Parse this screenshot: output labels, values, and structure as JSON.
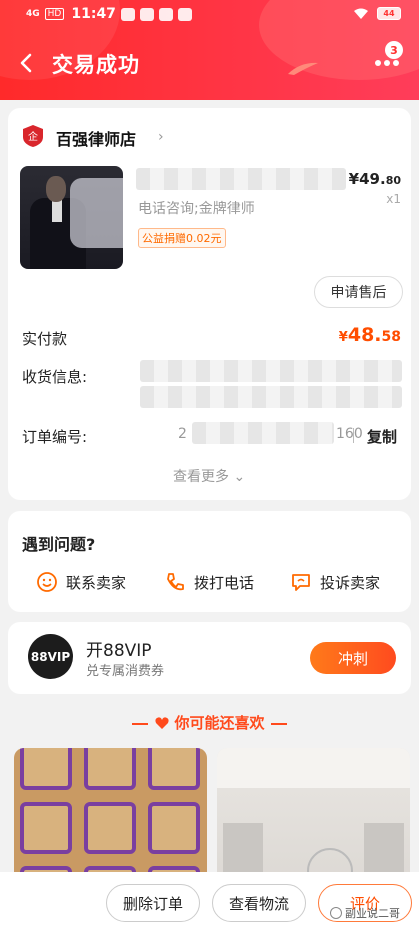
{
  "status_bar": {
    "signal": "4G",
    "hd": "HD",
    "time": "11:47",
    "battery": "44"
  },
  "header": {
    "title": "交易成功",
    "more_badge": "3"
  },
  "shop": {
    "name": "百强律师店"
  },
  "product": {
    "subtitle": "电话咨询;金牌律师",
    "charity_tag": "公益捐赠0.02元",
    "price_int": "¥49.",
    "price_dec": "80",
    "quantity": "x1",
    "after_sale_label": "申请售后"
  },
  "order": {
    "paid_label": "实付款",
    "paid_currency": "¥",
    "paid_int": "48.",
    "paid_dec": "58",
    "address_label": "收货信息:",
    "order_no_label": "订单编号:",
    "order_no_start": "2",
    "order_no_end": "160",
    "copy_label": "复制",
    "view_more": "查看更多"
  },
  "problems": {
    "title": "遇到问题?",
    "actions": [
      {
        "label": "联系卖家",
        "icon": "smile-chat-icon"
      },
      {
        "label": "拨打电话",
        "icon": "phone-icon"
      },
      {
        "label": "投诉卖家",
        "icon": "complaint-icon"
      }
    ]
  },
  "vip": {
    "logo": "88VIP",
    "title": "开88VIP",
    "subtitle": "兑专属消费券",
    "button": "冲刺"
  },
  "recommend": {
    "title": "你可能还喜欢"
  },
  "bottom_bar": {
    "delete_order": "删除订单",
    "view_logistics": "查看物流",
    "review": "评价"
  },
  "watermark": "副业说二哥",
  "colors": {
    "header_red": "#ff2a2a",
    "accent_orange": "#ff4d00",
    "charity_orange": "#ff6a00"
  }
}
